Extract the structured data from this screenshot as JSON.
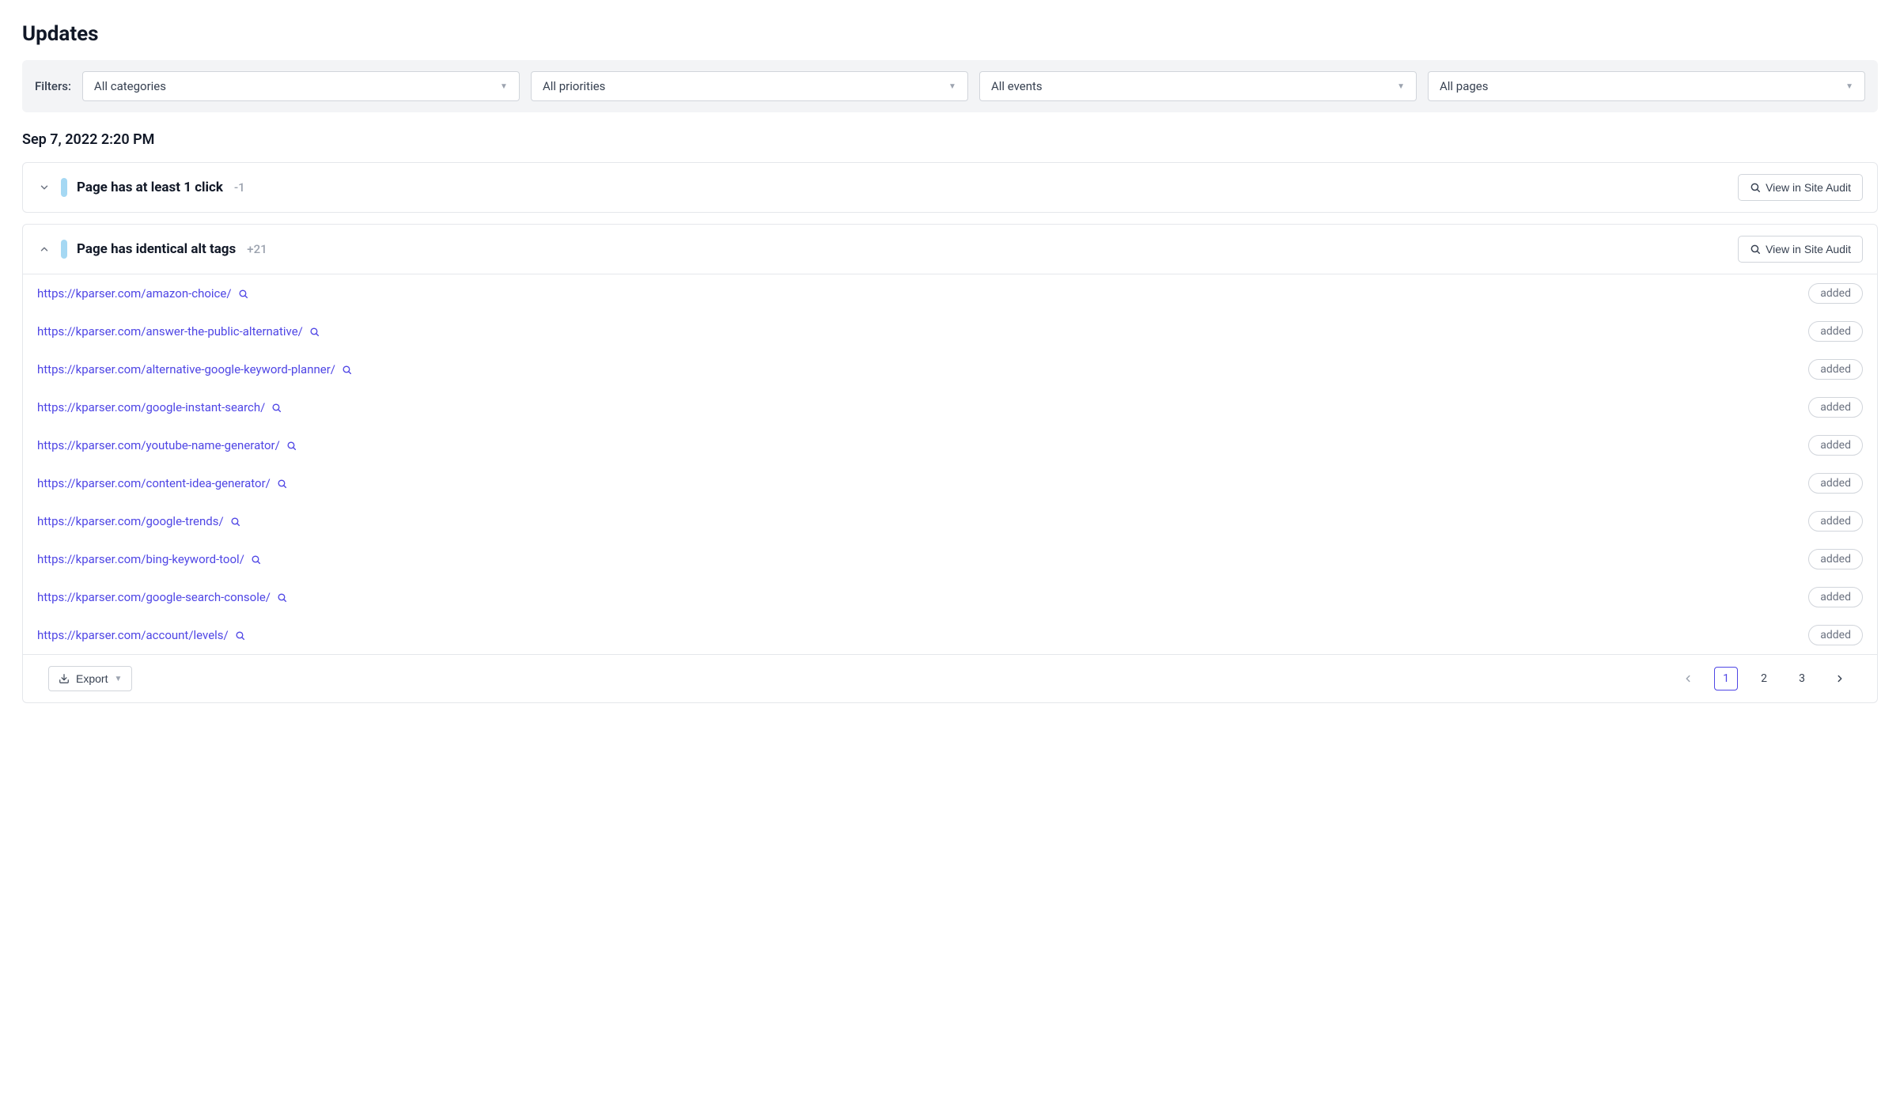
{
  "page": {
    "title": "Updates"
  },
  "filters": {
    "label": "Filters:",
    "categories": "All categories",
    "priorities": "All priorities",
    "events": "All events",
    "pages": "All pages"
  },
  "timestamp": "Sep 7, 2022 2:20 PM",
  "view_button_label": "View in Site Audit",
  "groups": [
    {
      "title": "Page has at least 1 click",
      "delta": "-1",
      "expanded": false
    },
    {
      "title": "Page has identical alt tags",
      "delta": "+21",
      "expanded": true,
      "rows": [
        {
          "url": "https://kparser.com/amazon-choice/",
          "status": "added"
        },
        {
          "url": "https://kparser.com/answer-the-public-alternative/",
          "status": "added"
        },
        {
          "url": "https://kparser.com/alternative-google-keyword-planner/",
          "status": "added"
        },
        {
          "url": "https://kparser.com/google-instant-search/",
          "status": "added"
        },
        {
          "url": "https://kparser.com/youtube-name-generator/",
          "status": "added"
        },
        {
          "url": "https://kparser.com/content-idea-generator/",
          "status": "added"
        },
        {
          "url": "https://kparser.com/google-trends/",
          "status": "added"
        },
        {
          "url": "https://kparser.com/bing-keyword-tool/",
          "status": "added"
        },
        {
          "url": "https://kparser.com/google-search-console/",
          "status": "added"
        },
        {
          "url": "https://kparser.com/account/levels/",
          "status": "added"
        }
      ]
    }
  ],
  "export_label": "Export",
  "pagination": {
    "pages": [
      "1",
      "2",
      "3"
    ],
    "active": "1"
  }
}
